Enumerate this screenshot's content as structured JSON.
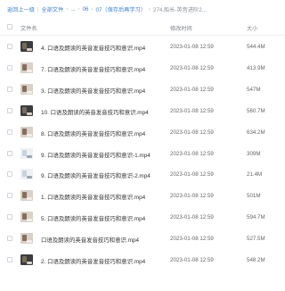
{
  "breadcrumb": {
    "back": "返回上一级",
    "root": "全部文件",
    "ellipsis": "...",
    "items": [
      "06",
      "07（保存后再学习）",
      "274.船长-英音进阶2..."
    ]
  },
  "table": {
    "columns": {
      "name": "文件名",
      "modified": "修改时间",
      "size": "大小"
    },
    "rows": [
      {
        "name": "4. 口语及朗读的英音发音技巧和意识.mp4",
        "modified": "2023-01-08 12:59",
        "size": "544.4M",
        "thumb": "thumb-dark"
      },
      {
        "name": "7. 口语及朗读的英音发音技巧和意识.mp4",
        "modified": "2023-01-08 12:59",
        "size": "413.9M",
        "thumb": "thumb-face"
      },
      {
        "name": "3. 口语及朗读的英音发音技巧和意识.mp4",
        "modified": "2023-01-08 12:59",
        "size": "547M",
        "thumb": "thumb-face"
      },
      {
        "name": "10. 口语及朗读的英音发音技巧和意识.mp4",
        "modified": "2023-01-08 12:59",
        "size": "560.7M",
        "thumb": "thumb-dark"
      },
      {
        "name": "8. 口语及朗读的英音发音技巧和意识.mp4",
        "modified": "2023-01-08 12:59",
        "size": "634.2M",
        "thumb": "thumb-face"
      },
      {
        "name": "9. 口语及朗读的英音发音技巧和意识-1.mp4",
        "modified": "2023-01-08 12:59",
        "size": "309M",
        "thumb": "thumb-screen"
      },
      {
        "name": "9. 口语及朗读的英音发音技巧和意识-2.mp4",
        "modified": "2023-01-08 12:59",
        "size": "21.4M",
        "thumb": "thumb-screen"
      },
      {
        "name": "1. 口语及朗读的英音发音技巧和意识.mp4",
        "modified": "2023-01-08 12:59",
        "size": "501M",
        "thumb": "thumb-face"
      },
      {
        "name": "5. 口语及朗读的英音发音技巧和意识.mp4",
        "modified": "2023-01-08 12:59",
        "size": "594.7M",
        "thumb": "thumb-face"
      },
      {
        "name": "口语及朗读的英音发音技巧和意识.mp4",
        "modified": "2023-01-08 12:59",
        "size": "527.5M",
        "thumb": "thumb-face"
      },
      {
        "name": "2. 口语及朗读的英音发音技巧和意识.mp4",
        "modified": "2023-01-08 12:59",
        "size": "548.2M",
        "thumb": "thumb-dark"
      }
    ]
  },
  "colors": {
    "link": "#3b82d6",
    "header_text": "#7d838d",
    "row_text": "#333333",
    "meta_text": "#666666"
  }
}
